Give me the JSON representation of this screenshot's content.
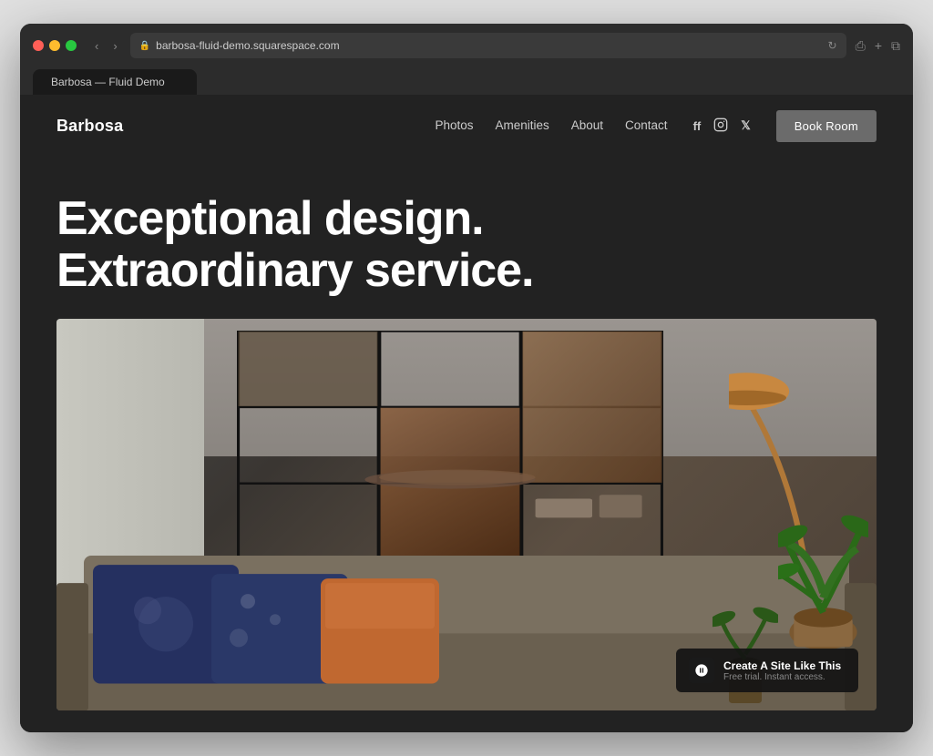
{
  "browser": {
    "url": "barbosa-fluid-demo.squarespace.com",
    "tab_title": "Barbosa — Fluid Demo"
  },
  "nav": {
    "logo": "Barbosa",
    "links": [
      {
        "label": "Photos",
        "href": "#"
      },
      {
        "label": "Amenities",
        "href": "#"
      },
      {
        "label": "About",
        "href": "#"
      },
      {
        "label": "Contact",
        "href": "#"
      }
    ],
    "cta_label": "Book Room"
  },
  "hero": {
    "headline_line1": "Exceptional design.",
    "headline_line2": "Extraordinary service."
  },
  "badge": {
    "title": "Create A Site Like This",
    "subtitle": "Free trial. Instant access."
  }
}
